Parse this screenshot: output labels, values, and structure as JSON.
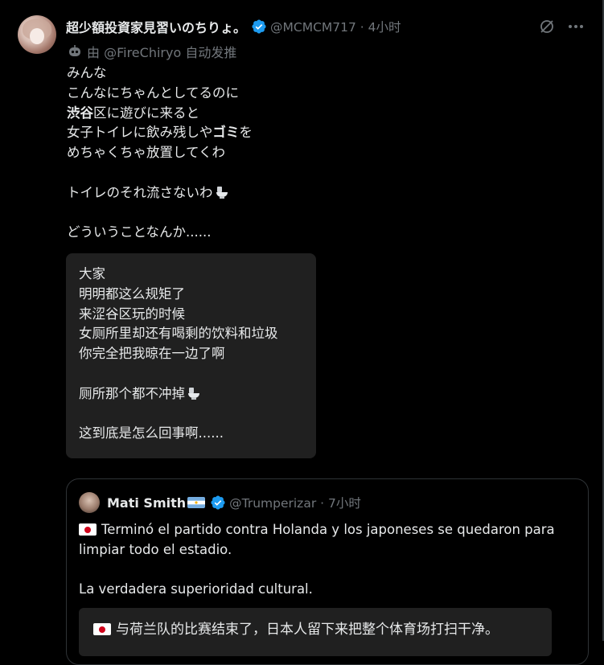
{
  "post": {
    "display_name": "超少額投資家見習いのちりょ。",
    "handle_time": "@MCMCM717 · 4小时",
    "via": "由 @FireChiryo 自动发推",
    "body_lines": [
      "みんな",
      "こんなにちゃんとしてるのに",
      "渋谷区に遊びに来ると",
      "女子トイレに飲み残しやゴミを",
      "めちゃくちゃ放置してくわ",
      "",
      "トイレのそれ流さないわ",
      "",
      "どういうことなんか......"
    ],
    "translation_lines": [
      "大家",
      "明明都这么规矩了",
      "来涩谷区玩的时候",
      "女厕所里却还有喝剩的饮料和垃圾",
      "你完全把我晾在一边了啊",
      "",
      "厕所那个都不冲掉",
      "",
      "这到底是怎么回事啊......"
    ]
  },
  "quote": {
    "display_name": "Mati Smith",
    "handle_time": "@Trumperizar · 7小时",
    "line1": "Terminó el partido contra Holanda y los japoneses se quedaron para",
    "line2": "limpiar todo el estadio.",
    "line3": "La verdadera superioridad cultural.",
    "translation": "与荷兰队的比赛结束了，日本人留下来把整个体育场打扫干净。"
  },
  "colors": {
    "accent": "#1d9bf0",
    "background": "#000000",
    "muted": "#71767b",
    "card": "#202020"
  },
  "icons": [
    "grok-icon",
    "more-icon",
    "robot-icon",
    "verified-icon",
    "toilet-icon",
    "japan-flag-icon",
    "argentina-flag-icon"
  ]
}
